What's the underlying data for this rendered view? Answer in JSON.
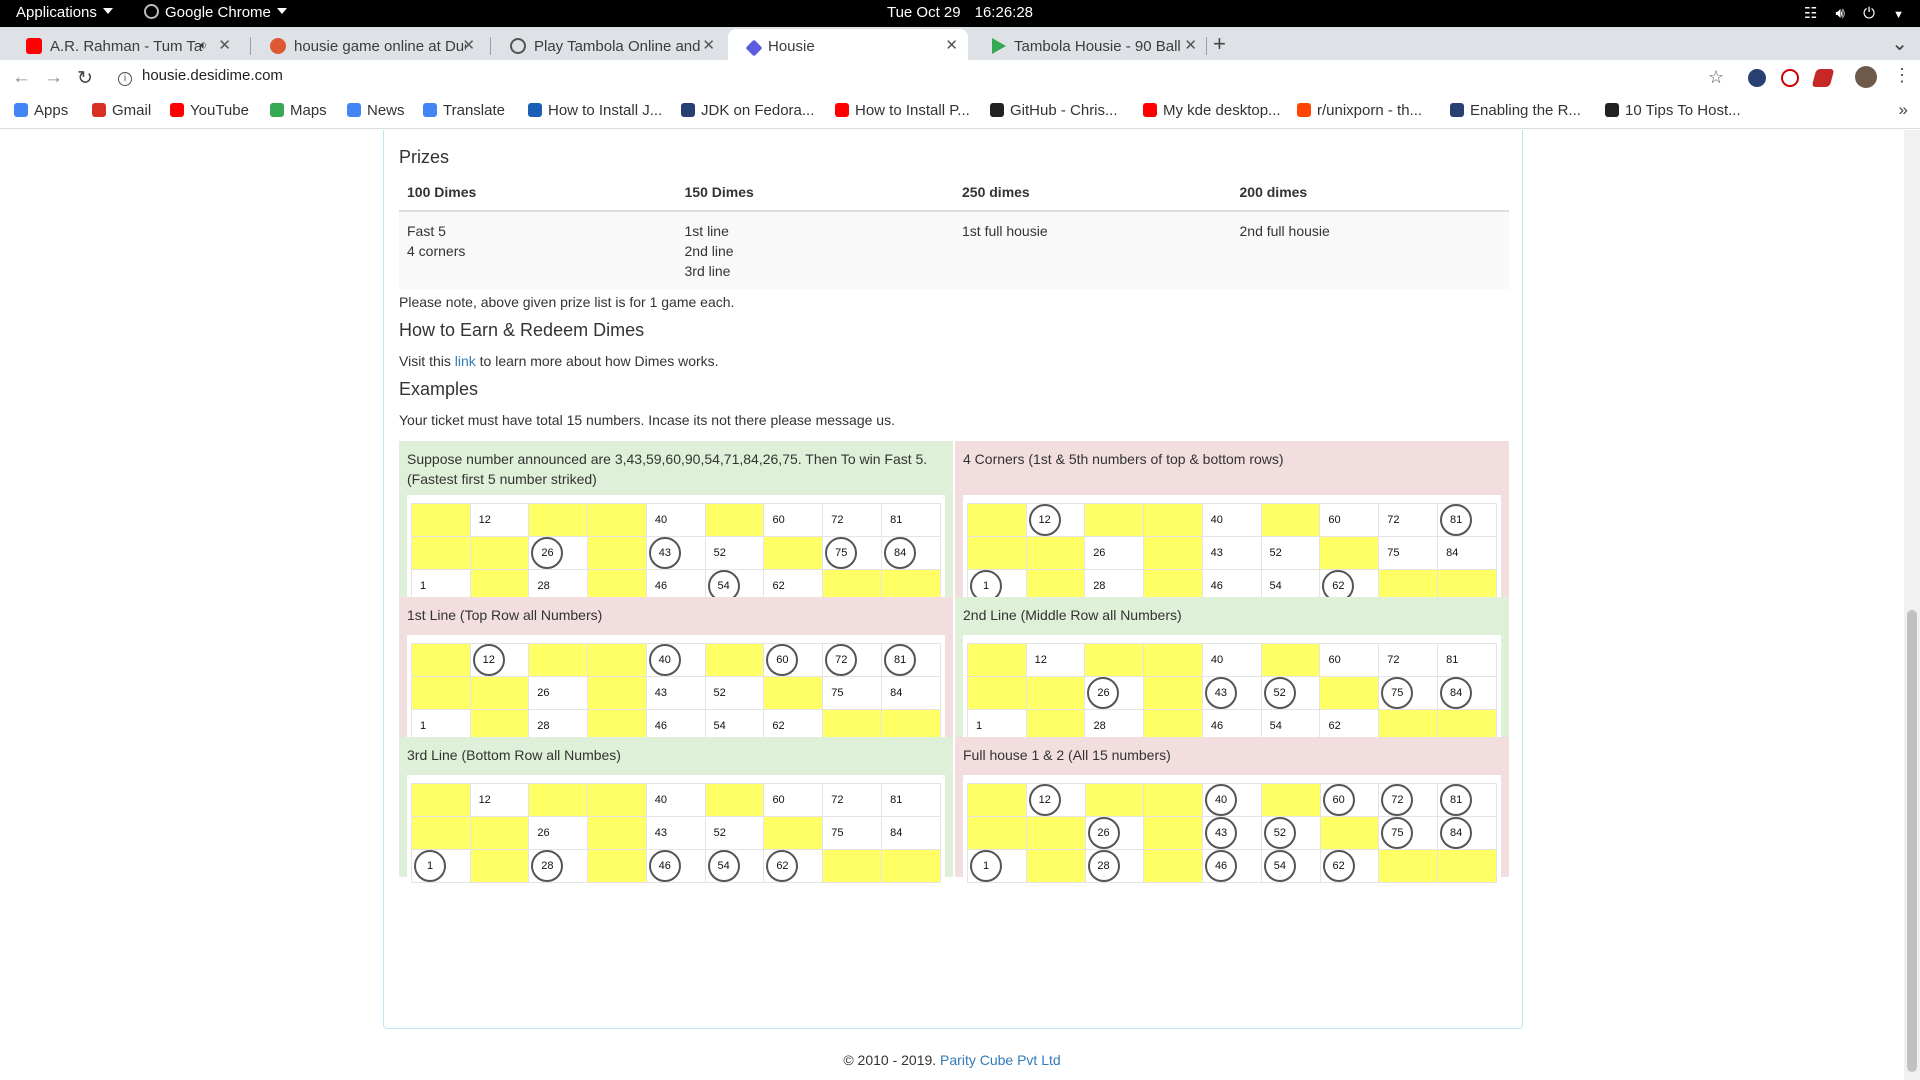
{
  "topbar": {
    "applications": "Applications",
    "chrome": "Google Chrome",
    "date": "Tue Oct 29",
    "time": "16:26:28"
  },
  "tabs": [
    {
      "title": "A.R. Rahman - Tum Ta",
      "color": "#ff0000"
    },
    {
      "title": "housie game online at Duc",
      "color": "#de5833"
    },
    {
      "title": "Play Tambola Online and",
      "color": "#555555"
    },
    {
      "title": "Housie",
      "color": "#5b5be0"
    },
    {
      "title": "Tambola Housie - 90 Ball",
      "color": "#34a853"
    }
  ],
  "url": "housie.desidime.com",
  "bookmarks": [
    {
      "label": "Apps",
      "color": "#4285f4"
    },
    {
      "label": "Gmail",
      "color": "#d93025"
    },
    {
      "label": "YouTube",
      "color": "#ff0000"
    },
    {
      "label": "Maps",
      "color": "#34a853"
    },
    {
      "label": "News",
      "color": "#4285f4"
    },
    {
      "label": "Translate",
      "color": "#4285f4"
    },
    {
      "label": "How to Install J...",
      "color": "#1a5fb4"
    },
    {
      "label": "JDK on Fedora...",
      "color": "#294172"
    },
    {
      "label": "How to Install P...",
      "color": "#ff0000"
    },
    {
      "label": "GitHub - Chris...",
      "color": "#222222"
    },
    {
      "label": "My kde desktop...",
      "color": "#ff0000"
    },
    {
      "label": "r/unixporn - th...",
      "color": "#ff4500"
    },
    {
      "label": "Enabling the R...",
      "color": "#294172"
    },
    {
      "label": "10 Tips To Host...",
      "color": "#222222"
    }
  ],
  "prizes": {
    "title": "Prizes",
    "headers": [
      "100 Dimes",
      "150 Dimes",
      "250 dimes",
      "200 dimes"
    ],
    "cells": [
      [
        "Fast 5",
        "4 corners"
      ],
      [
        "1st line",
        "2nd line",
        "3rd line"
      ],
      [
        "1st full housie"
      ],
      [
        "2nd full housie"
      ]
    ],
    "note": "Please note, above given prize list is for 1 game each."
  },
  "earn": {
    "title": "How to Earn & Redeem Dimes",
    "before": "Visit this ",
    "link": "link",
    "after": " to learn more about how Dimes works."
  },
  "examples": {
    "title": "Examples",
    "note": "Your ticket must have total 15 numbers. Incase its not there please message us.",
    "ticket": [
      [
        "",
        "12",
        "",
        "",
        "40",
        "",
        "60",
        "72",
        "81"
      ],
      [
        "",
        "",
        "26",
        "",
        "43",
        "52",
        "",
        "75",
        "84"
      ],
      [
        "1",
        "",
        "28",
        "",
        "46",
        "54",
        "62",
        "",
        ""
      ]
    ],
    "items": [
      {
        "label": "Suppose number announced are 3,43,59,60,90,54,71,84,26,75. Then To win Fast 5. (Fastest first 5 number striked)",
        "tone": "green",
        "hits": [
          "26",
          "43",
          "54",
          "75",
          "84"
        ]
      },
      {
        "label": "4 Corners (1st & 5th numbers of top & bottom rows)",
        "tone": "red",
        "hits": [
          "12",
          "81",
          "1",
          "62"
        ]
      },
      {
        "label": "1st Line (Top Row all Numbers)",
        "tone": "red",
        "hits": [
          "12",
          "40",
          "60",
          "72",
          "81"
        ]
      },
      {
        "label": "2nd Line (Middle Row all Numbers)",
        "tone": "green",
        "hits": [
          "26",
          "43",
          "52",
          "75",
          "84"
        ]
      },
      {
        "label": "3rd Line (Bottom Row all Numbes)",
        "tone": "green",
        "hits": [
          "1",
          "28",
          "46",
          "54",
          "62"
        ]
      },
      {
        "label": "Full house 1 & 2 (All 15 numbers)",
        "tone": "red",
        "hits": [
          "12",
          "40",
          "60",
          "72",
          "81",
          "26",
          "43",
          "52",
          "75",
          "84",
          "1",
          "28",
          "46",
          "54",
          "62"
        ]
      }
    ]
  },
  "footer": {
    "copyright": "© 2010 - 2019. ",
    "company": "Parity Cube Pvt Ltd"
  }
}
